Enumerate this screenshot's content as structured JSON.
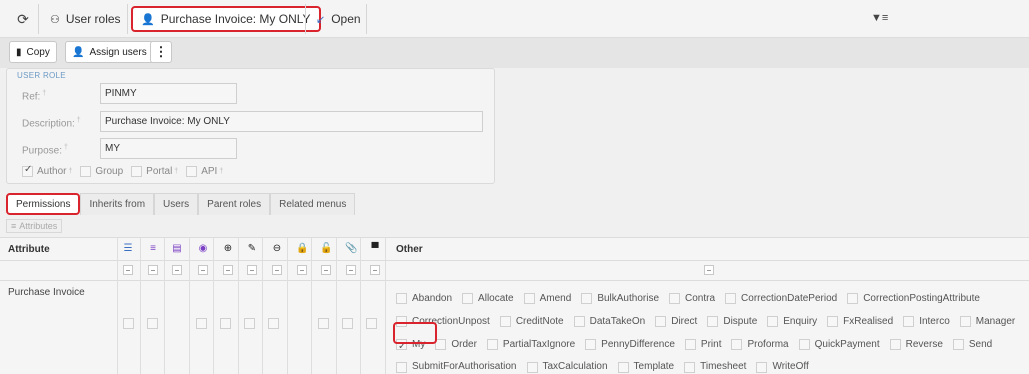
{
  "topbar": {
    "tabs": [
      {
        "label": "User roles",
        "icon": "user-roles-icon"
      },
      {
        "label": "Purchase Invoice: My ONLY",
        "icon": "user-icon"
      },
      {
        "label": "Open",
        "icon": "open-icon"
      }
    ]
  },
  "toolbar": {
    "copy_label": "Copy",
    "assign_label": "Assign users",
    "more_label": "⋮"
  },
  "role": {
    "legend": "USER ROLE",
    "ref_label": "Ref:",
    "ref_value": "PINMY",
    "desc_label": "Description:",
    "desc_value": "Purchase Invoice: My ONLY",
    "purpose_label": "Purpose:",
    "purpose_value": "MY",
    "checks": [
      {
        "label": "Author",
        "checked": true
      },
      {
        "label": "Group",
        "checked": false
      },
      {
        "label": "Portal",
        "checked": false
      },
      {
        "label": "API",
        "checked": false
      }
    ]
  },
  "tabs": [
    "Permissions",
    "Inherits from",
    "Users",
    "Parent roles",
    "Related menus"
  ],
  "attributes_button": "Attributes",
  "grid": {
    "col_attribute": "Attribute",
    "col_other": "Other",
    "row_label": "Purchase Invoice",
    "other_items": [
      {
        "label": "Abandon",
        "checked": false
      },
      {
        "label": "Allocate",
        "checked": false
      },
      {
        "label": "Amend",
        "checked": false
      },
      {
        "label": "BulkAuthorise",
        "checked": false
      },
      {
        "label": "Contra",
        "checked": false
      },
      {
        "label": "CorrectionDatePeriod",
        "checked": false
      },
      {
        "label": "CorrectionPostingAttribute",
        "checked": false
      },
      {
        "label": "CorrectionUnpost",
        "checked": false
      },
      {
        "label": "CreditNote",
        "checked": false
      },
      {
        "label": "DataTakeOn",
        "checked": false
      },
      {
        "label": "Direct",
        "checked": false
      },
      {
        "label": "Dispute",
        "checked": false
      },
      {
        "label": "Enquiry",
        "checked": false
      },
      {
        "label": "FxRealised",
        "checked": false
      },
      {
        "label": "Interco",
        "checked": false
      },
      {
        "label": "Manager",
        "checked": false
      },
      {
        "label": "My",
        "checked": true
      },
      {
        "label": "Order",
        "checked": false
      },
      {
        "label": "PartialTaxIgnore",
        "checked": false
      },
      {
        "label": "PennyDifference",
        "checked": false
      },
      {
        "label": "Print",
        "checked": false
      },
      {
        "label": "Proforma",
        "checked": false
      },
      {
        "label": "QuickPayment",
        "checked": false
      },
      {
        "label": "Reverse",
        "checked": false
      },
      {
        "label": "Send",
        "checked": false
      },
      {
        "label": "SubmitForAuthorisation",
        "checked": false
      },
      {
        "label": "TaxCalculation",
        "checked": false
      },
      {
        "label": "Template",
        "checked": false
      },
      {
        "label": "Timesheet",
        "checked": false
      },
      {
        "label": "WriteOff",
        "checked": false
      }
    ]
  }
}
